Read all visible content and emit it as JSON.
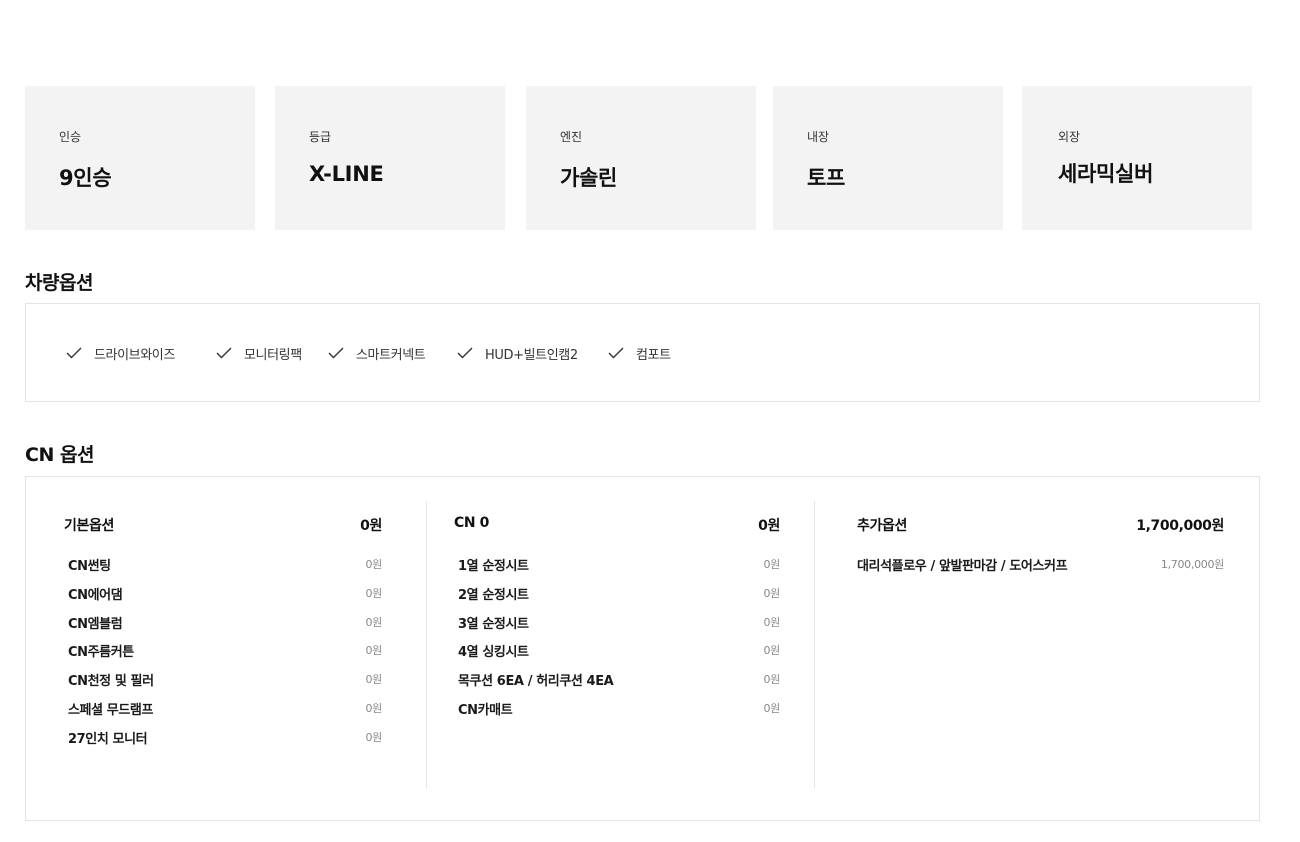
{
  "specs": [
    {
      "label": "인승",
      "value": "9인승"
    },
    {
      "label": "등급",
      "value": "X-LINE"
    },
    {
      "label": "엔진",
      "value": "가솔린"
    },
    {
      "label": "내장",
      "value": "토프"
    },
    {
      "label": "외장",
      "value": "세라믹실버"
    }
  ],
  "vehicle_options": {
    "title": "차량옵션",
    "items": [
      "드라이브와이즈",
      "모니터링팩",
      "스마트커넥트",
      "HUD+빌트인캠2",
      "컴포트"
    ]
  },
  "cn_options": {
    "title": "CN 옵션",
    "columns": [
      {
        "name": "기본옵션",
        "price": "0원",
        "items": [
          {
            "name": "CN썬팅",
            "price": "0원"
          },
          {
            "name": "CN에어댐",
            "price": "0원"
          },
          {
            "name": "CN엠블럼",
            "price": "0원"
          },
          {
            "name": "CN주름커튼",
            "price": "0원"
          },
          {
            "name": "CN천정 및 필러",
            "price": "0원"
          },
          {
            "name": "스페셜 무드램프",
            "price": "0원"
          },
          {
            "name": "27인치 모니터",
            "price": "0원"
          }
        ]
      },
      {
        "name": "CN 0",
        "price": "0원",
        "items": [
          {
            "name": "1열 순정시트",
            "price": "0원"
          },
          {
            "name": "2열 순정시트",
            "price": "0원"
          },
          {
            "name": "3열 순정시트",
            "price": "0원"
          },
          {
            "name": "4열 싱킹시트",
            "price": "0원"
          },
          {
            "name": "목쿠션 6EA / 허리쿠션 4EA",
            "price": "0원"
          },
          {
            "name": "CN카매트",
            "price": "0원"
          }
        ]
      },
      {
        "name": "추가옵션",
        "price": "1,700,000원",
        "items": [
          {
            "name": "대리석플로우 / 앞발판마감 / 도어스커프",
            "price": "1,700,000원"
          }
        ]
      }
    ]
  },
  "colors": {
    "card_bg": "#f3f3f3",
    "border": "#e4e4e4",
    "text": "#111111",
    "muted": "#888888"
  },
  "icons": {
    "option_check": "check-icon"
  }
}
